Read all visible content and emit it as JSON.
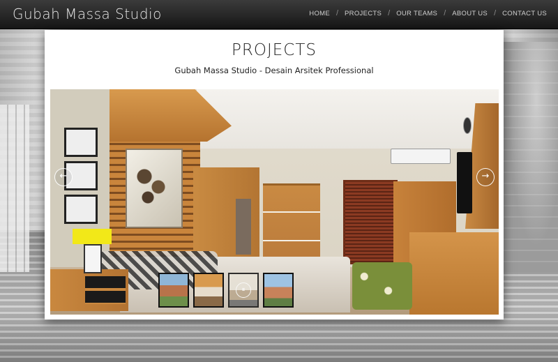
{
  "header": {
    "logo": "Gubah Massa Studio",
    "nav": [
      {
        "label": "HOME"
      },
      {
        "label": "PROJECTS"
      },
      {
        "label": "OUR TEAMS"
      },
      {
        "label": "ABOUT US"
      },
      {
        "label": "CONTACT US"
      }
    ],
    "separator": "/"
  },
  "main": {
    "title": "PROJECTS",
    "subtitle": "Gubah Massa Studio - Desain Arsitek Professional"
  },
  "slider": {
    "prev_icon": "←",
    "next_icon": "→",
    "play_icon": "⏸",
    "thumbnail_count": 4
  },
  "colors": {
    "navbar": "#1f1f1f",
    "panel": "#ffffff",
    "text": "#222222"
  }
}
